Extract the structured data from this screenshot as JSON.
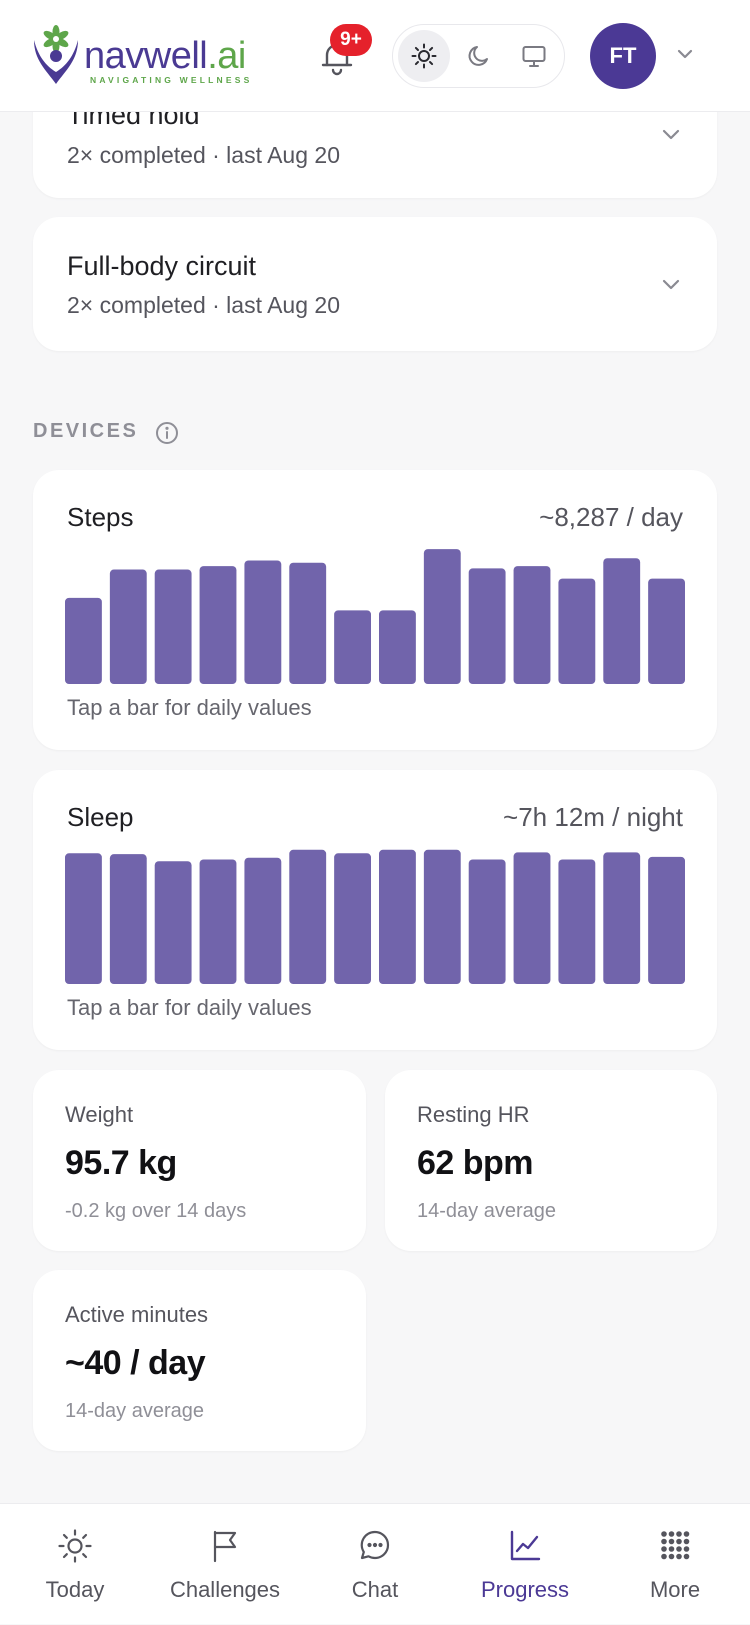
{
  "header": {
    "brand_main": "navwell",
    "brand_suffix": ".ai",
    "tagline": "NAVIGATING WELLNESS",
    "notification_badge": "9+",
    "theme_options": [
      "light",
      "dark",
      "system"
    ],
    "theme_selected": "light",
    "avatar_initials": "FT",
    "brand_colors": {
      "primary": "#4b3995",
      "secondary": "#5ea64a",
      "badge": "#e5212b"
    }
  },
  "exercises": [
    {
      "title": "Timed hold",
      "subtitle": "2× completed · last Aug 20"
    },
    {
      "title": "Full-body circuit",
      "subtitle": "2× completed · last Aug 20"
    }
  ],
  "devices": {
    "section_label": "DEVICES",
    "bar_color": "#7164ab",
    "steps": {
      "title": "Steps",
      "summary": "~8,287 / day",
      "hint": "Tap a bar for daily values",
      "max": 12000,
      "values": [
        7600,
        10100,
        10100,
        10400,
        10900,
        10700,
        6500,
        6500,
        11900,
        10200,
        10400,
        9300,
        11100,
        9300
      ]
    },
    "sleep": {
      "title": "Sleep",
      "summary": "~7h 12m / night",
      "hint": "Tap a bar for daily values",
      "max_hours": 7.7,
      "values_hours": [
        7.4,
        7.35,
        6.95,
        7.05,
        7.15,
        7.6,
        7.4,
        7.6,
        7.6,
        7.05,
        7.45,
        7.05,
        7.45,
        7.2
      ]
    },
    "stats": [
      {
        "label": "Weight",
        "value": "95.7 kg",
        "sub": "-0.2 kg over 14 days"
      },
      {
        "label": "Resting HR",
        "value": "62 bpm",
        "sub": "14-day average"
      },
      {
        "label": "Active minutes",
        "value": "~40 / day",
        "sub": "14-day average"
      }
    ]
  },
  "nav": {
    "items": [
      {
        "label": "Today",
        "icon": "sun-icon"
      },
      {
        "label": "Challenges",
        "icon": "flag-icon"
      },
      {
        "label": "Chat",
        "icon": "chat-icon"
      },
      {
        "label": "Progress",
        "icon": "chart-line-icon"
      },
      {
        "label": "More",
        "icon": "grid-icon"
      }
    ],
    "active": "Progress",
    "active_color": "#4b3995"
  }
}
